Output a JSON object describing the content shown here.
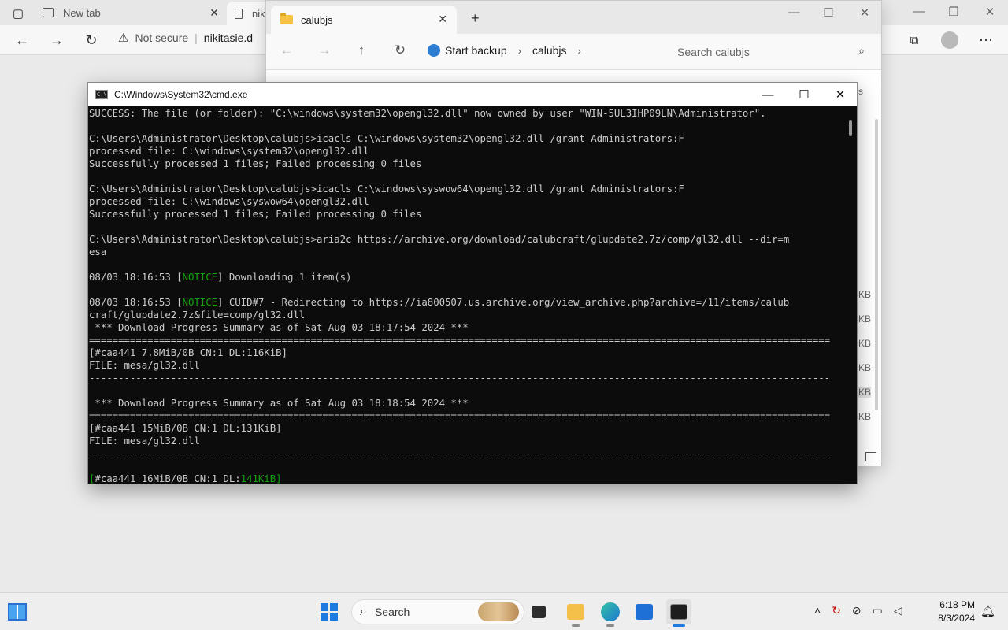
{
  "browser": {
    "tabs": [
      {
        "label": "New tab"
      },
      {
        "label": "nik"
      }
    ],
    "address": {
      "security": "Not secure",
      "url": "nikitasie.d"
    }
  },
  "explorer": {
    "tab_title": "calubjs",
    "breadcrumbs": [
      "Start backup",
      "calubjs"
    ],
    "search_placeholder": "Search calubjs",
    "sizes": [
      "KB",
      "KB",
      "KB",
      "KB",
      "KB",
      "KB"
    ],
    "partial_text": "s"
  },
  "cmd": {
    "title": "C:\\Windows\\System32\\cmd.exe",
    "lines": [
      "SUCCESS: The file (or folder): \"C:\\windows\\system32\\opengl32.dll\" now owned by user \"WIN-5UL3IHP09LN\\Administrator\".",
      "",
      "C:\\Users\\Administrator\\Desktop\\calubjs>icacls C:\\windows\\system32\\opengl32.dll /grant Administrators:F",
      "processed file: C:\\windows\\system32\\opengl32.dll",
      "Successfully processed 1 files; Failed processing 0 files",
      "",
      "C:\\Users\\Administrator\\Desktop\\calubjs>icacls C:\\windows\\syswow64\\opengl32.dll /grant Administrators:F",
      "processed file: C:\\windows\\syswow64\\opengl32.dll",
      "Successfully processed 1 files; Failed processing 0 files",
      "",
      "C:\\Users\\Administrator\\Desktop\\calubjs>aria2c https://archive.org/download/calubcraft/glupdate2.7z/comp/gl32.dll --dir=m",
      "esa",
      "",
      "08/03 18:16:53 [NOTICE] Downloading 1 item(s)",
      "",
      "08/03 18:16:53 [NOTICE] CUID#7 - Redirecting to https://ia800507.us.archive.org/view_archive.php?archive=/11/items/calub",
      "craft/glupdate2.7z&file=comp/gl32.dll",
      " *** Download Progress Summary as of Sat Aug 03 18:17:54 2024 ***",
      "===============================================================================================================================",
      "[#caa441 7.8MiB/0B CN:1 DL:116KiB]",
      "FILE: mesa/gl32.dll",
      "-------------------------------------------------------------------------------------------------------------------------------",
      "",
      " *** Download Progress Summary as of Sat Aug 03 18:18:54 2024 ***",
      "===============================================================================================================================",
      "[#caa441 15MiB/0B CN:1 DL:131KiB]",
      "FILE: mesa/gl32.dll",
      "-------------------------------------------------------------------------------------------------------------------------------",
      "",
      "[#caa441 16MiB/0B CN:1 DL:141KiB]"
    ],
    "highlight_word": "NOTICE",
    "highlight_dl": "141KiB"
  },
  "taskbar": {
    "search_label": "Search",
    "time": "6:18 PM",
    "date": "8/3/2024"
  },
  "colors": {
    "console_bg": "#0c0c0c",
    "console_text": "#cccccc",
    "console_green": "#13a10e",
    "accent": "#1f7ae0"
  }
}
